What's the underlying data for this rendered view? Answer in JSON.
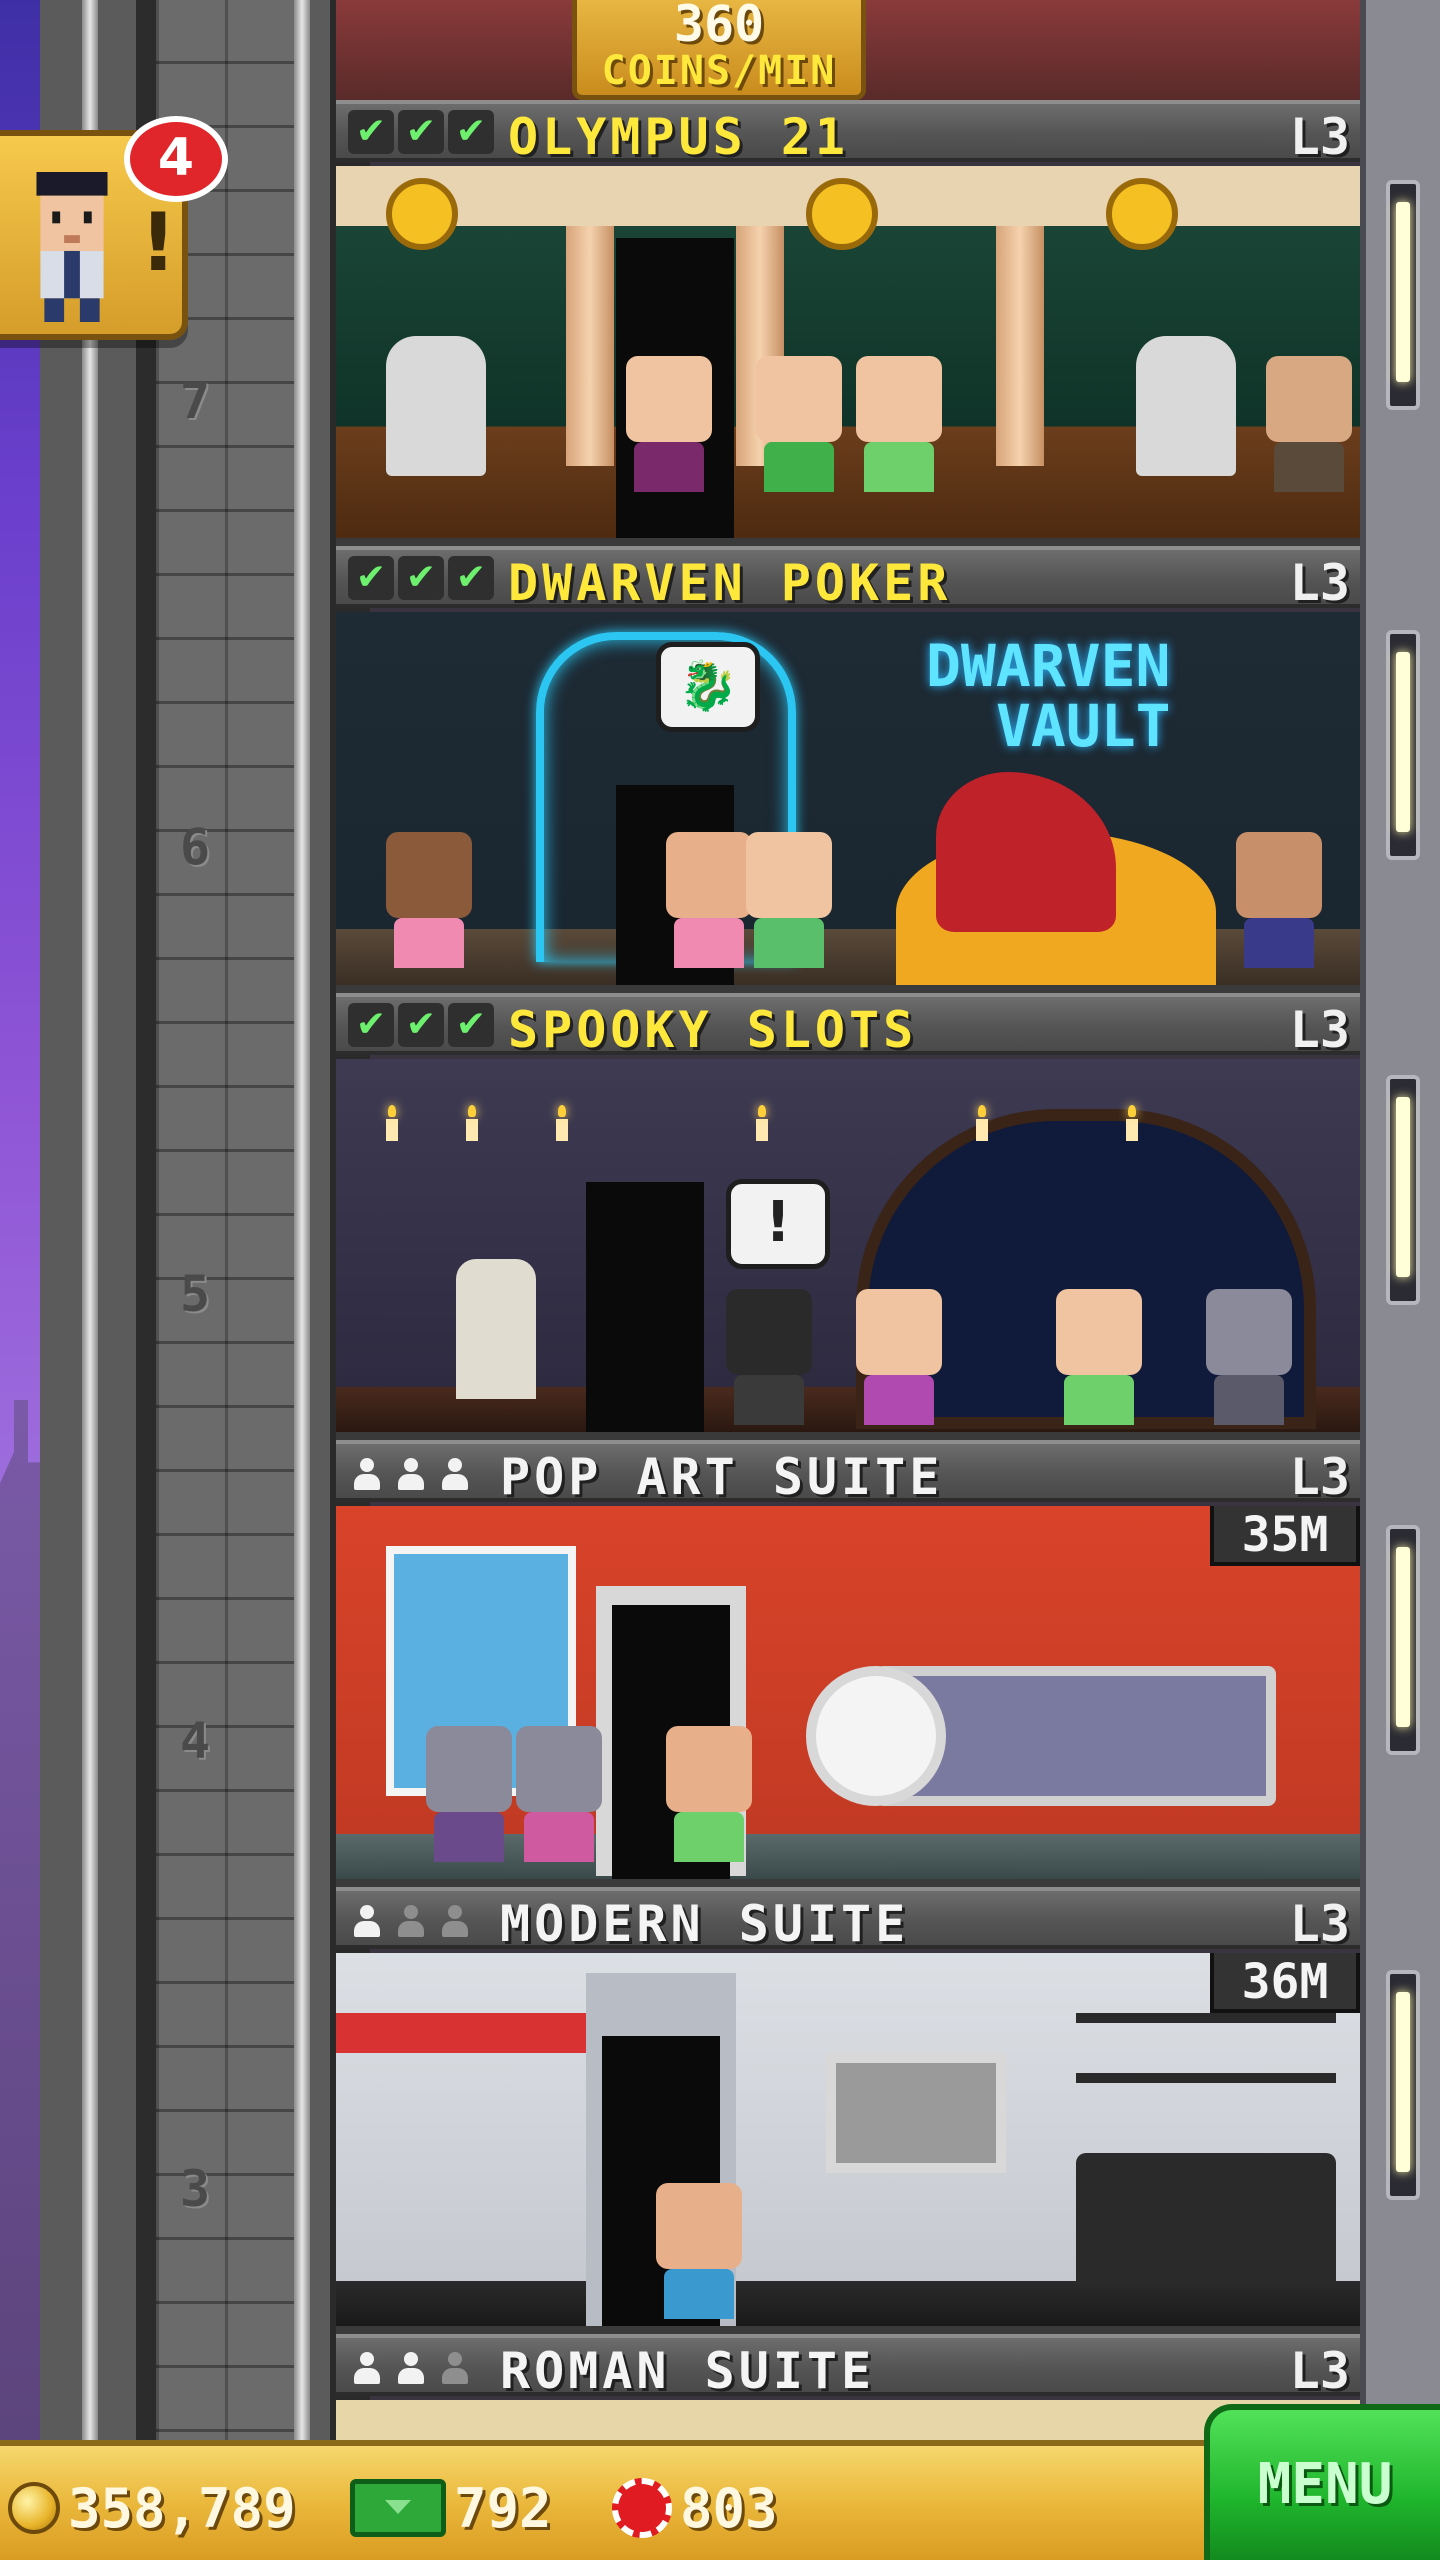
{
  "banner": {
    "coins_per_min_value": "360",
    "coins_per_min_unit": "COINS/MIN"
  },
  "notification": {
    "count": "4",
    "alert_glyph": "!"
  },
  "floors": [
    {
      "number": "7",
      "name": "OLYMPUS 21",
      "level": "L3",
      "type": "business",
      "checks": 3
    },
    {
      "number": "6",
      "name": "DWARVEN POKER",
      "level": "L3",
      "type": "business",
      "checks": 3,
      "sign_line1": "DWARVEN",
      "sign_line2": "VAULT"
    },
    {
      "number": "5",
      "name": "SPOOKY SLOTS",
      "level": "L3",
      "type": "business",
      "checks": 3,
      "bubble": "!"
    },
    {
      "number": "4",
      "name": "POP ART SUITE",
      "level": "L3",
      "type": "residential",
      "occupied": 3,
      "timer": "35M"
    },
    {
      "number": "3",
      "name": "MODERN SUITE",
      "level": "L3",
      "type": "residential",
      "occupied": 1,
      "timer": "36M"
    },
    {
      "number": "",
      "name": "ROMAN SUITE",
      "level": "L3",
      "type": "residential",
      "occupied": 2
    }
  ],
  "check_glyph": "✔",
  "resources": {
    "coins": "358,789",
    "bux": "792",
    "chips": "803"
  },
  "menu_label": "MENU",
  "icons": [
    "coin-icon",
    "bux-icon",
    "chip-icon",
    "check-icon",
    "person-icon",
    "alert-icon"
  ],
  "colors": {
    "business_title": "#ffe83c",
    "residential_title": "#f4f4f4",
    "menu_green": "#1fb52c",
    "gold_bar": "#eab83c",
    "badge_red": "#e0262a"
  }
}
